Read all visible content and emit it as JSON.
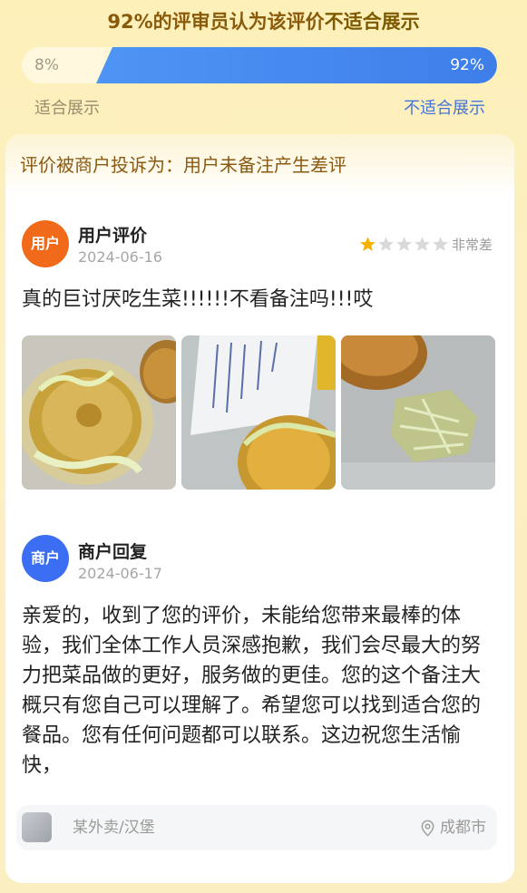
{
  "verdict": {
    "percent": "92%",
    "text": "的评审员认为该评价",
    "conclusion": "不适合展示"
  },
  "vote": {
    "suitable_pct": "8%",
    "unsuitable_pct": "92%",
    "suitable_label": "适合展示",
    "unsuitable_label": "不适合展示",
    "unsuitable_fraction": 0.92
  },
  "complaint": "评价被商户投诉为：用户未备注产生差评",
  "review": {
    "avatar_text": "用户",
    "title": "用户评价",
    "date": "2024-06-16",
    "rating": 1,
    "rating_max": 5,
    "rating_label": "非常差",
    "text": "真的巨讨厌吃生菜!!!!!!不看备注吗!!!哎",
    "photos": [
      "pineapple-burger-photo",
      "receipt-burger-photo",
      "lettuce-photo"
    ]
  },
  "reply": {
    "avatar_text": "商户",
    "title": "商户回复",
    "date": "2024-06-17",
    "text": "亲爱的，收到了您的评价，未能给您带来最棒的体验，我们全体工作人员深感抱歉，我们会尽最大的努力把菜品做的更好，服务做的更佳。您的这个备注大概只有您自己可以理解了。希望您可以找到适合您的餐品。您有任何问题都可以联系。这边祝您生活愉快，"
  },
  "footer": {
    "shop": "某外卖/汉堡",
    "location": "成都市",
    "shop_icon": "shop-thumbnail-icon",
    "location_icon": "location-pin-icon"
  },
  "colors": {
    "accent_blue": "#3e7ee9",
    "user_avatar": "#f06a1a",
    "merchant_avatar": "#3c6ef3",
    "star_filled": "#f5b300",
    "star_empty": "#d9d9d9"
  }
}
